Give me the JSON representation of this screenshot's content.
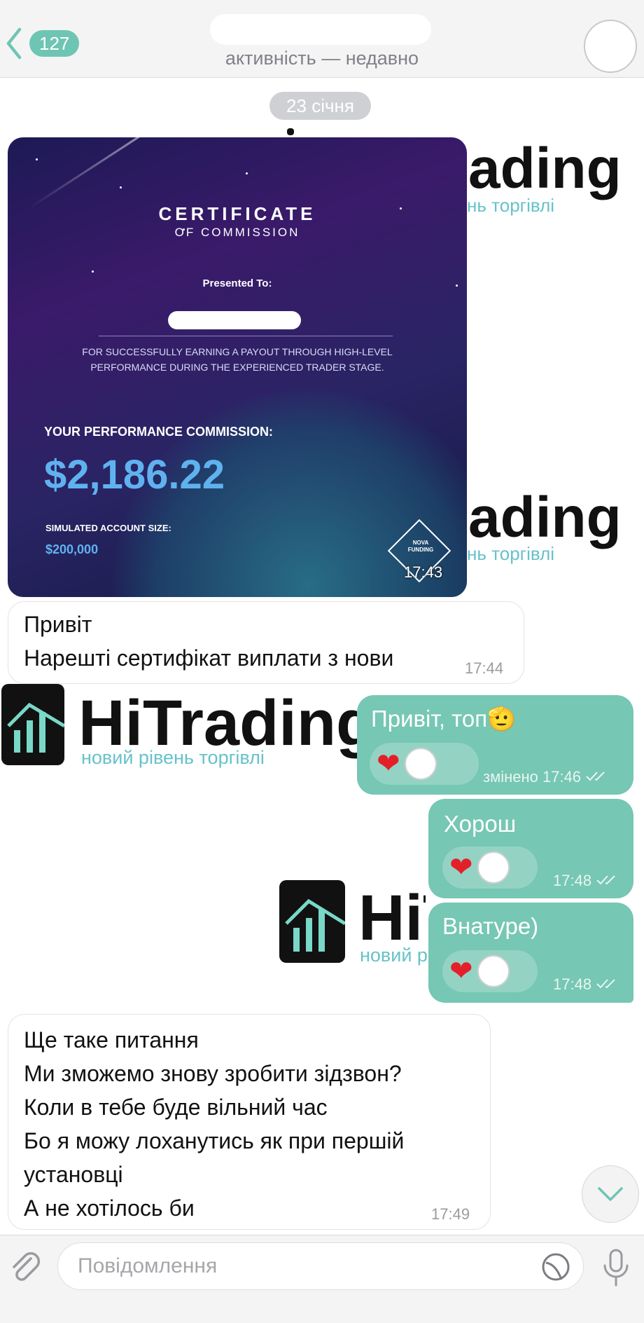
{
  "header": {
    "unread_count": "127",
    "status": "активність — недавно"
  },
  "date_separator": "23 січня",
  "watermark": {
    "brand": "HiTrading",
    "tagline": "новий рівень торгівлі",
    "brand_fragment": "ading",
    "tagline_fragment": "нь торгівлі"
  },
  "certificate": {
    "title": "CERTIFICATE",
    "subtitle": "OF COMMISSION",
    "presented_to": "Presented To:",
    "body_line1": "FOR SUCCESSFULLY EARNING A PAYOUT THROUGH HIGH-LEVEL",
    "body_line2": "PERFORMANCE DURING THE EXPERIENCED TRADER STAGE.",
    "commission_label": "YOUR PERFORMANCE COMMISSION:",
    "commission_amount": "$2,186.22",
    "account_label": "SIMULATED ACCOUNT SIZE:",
    "account_size": "$200,000",
    "logo_line1": "NOVA",
    "logo_line2": "FUNDING",
    "time": "17:43"
  },
  "messages": [
    {
      "lines": [
        "Привіт",
        "Нарешті сертифікат виплати з нови"
      ],
      "time": "17:44"
    },
    {
      "text": "Привіт, топ🫡",
      "time": "змінено 17:46"
    },
    {
      "text": "Хорош",
      "time": "17:48"
    },
    {
      "text": "Внатуре)",
      "time": "17:48"
    },
    {
      "lines": [
        "Ще таке питання",
        "Ми зможемо знову зробити зідзвон?",
        "Коли в тебе буде вільний час",
        "Бо я можу лоханутись як при першій",
        "установці",
        "А не хотілось би"
      ],
      "time": "17:49"
    }
  ],
  "reaction_heart": "❤",
  "input": {
    "placeholder": "Повідомлення"
  },
  "colors": {
    "accent": "#76c7b3",
    "badge": "#6fc5b3",
    "heart": "#e3202a",
    "watermark_tagline": "#67c2c9"
  },
  "icons": [
    "chevron-left-icon",
    "paperclip-icon",
    "sticker-icon",
    "microphone-icon",
    "chevron-down-icon",
    "double-check-icon"
  ]
}
